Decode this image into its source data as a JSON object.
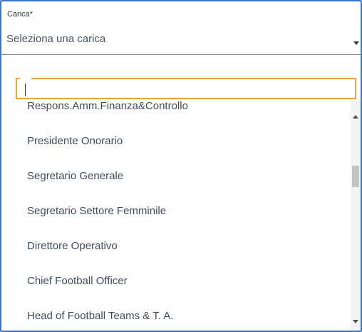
{
  "field": {
    "label": "Carica*",
    "selected_value": "Seleziona una carica"
  },
  "dropdown": {
    "search_value": "",
    "items": [
      "Respons.Amm.Finanza&Controllo",
      "Presidente Onorario",
      "Segretario Generale",
      "Segretario Settore Femminile",
      "Direttore Operativo",
      "Chief Football Officer",
      "Head of Football Teams & T. A."
    ]
  },
  "icons": {
    "select_caret": "caret-down-icon",
    "scroll_up": "scroll-up-icon",
    "scroll_down": "scroll-down-icon"
  },
  "colors": {
    "frame_border": "#3b74c9",
    "search_focus_border": "#f0a236",
    "text": "#3f4b5e"
  }
}
